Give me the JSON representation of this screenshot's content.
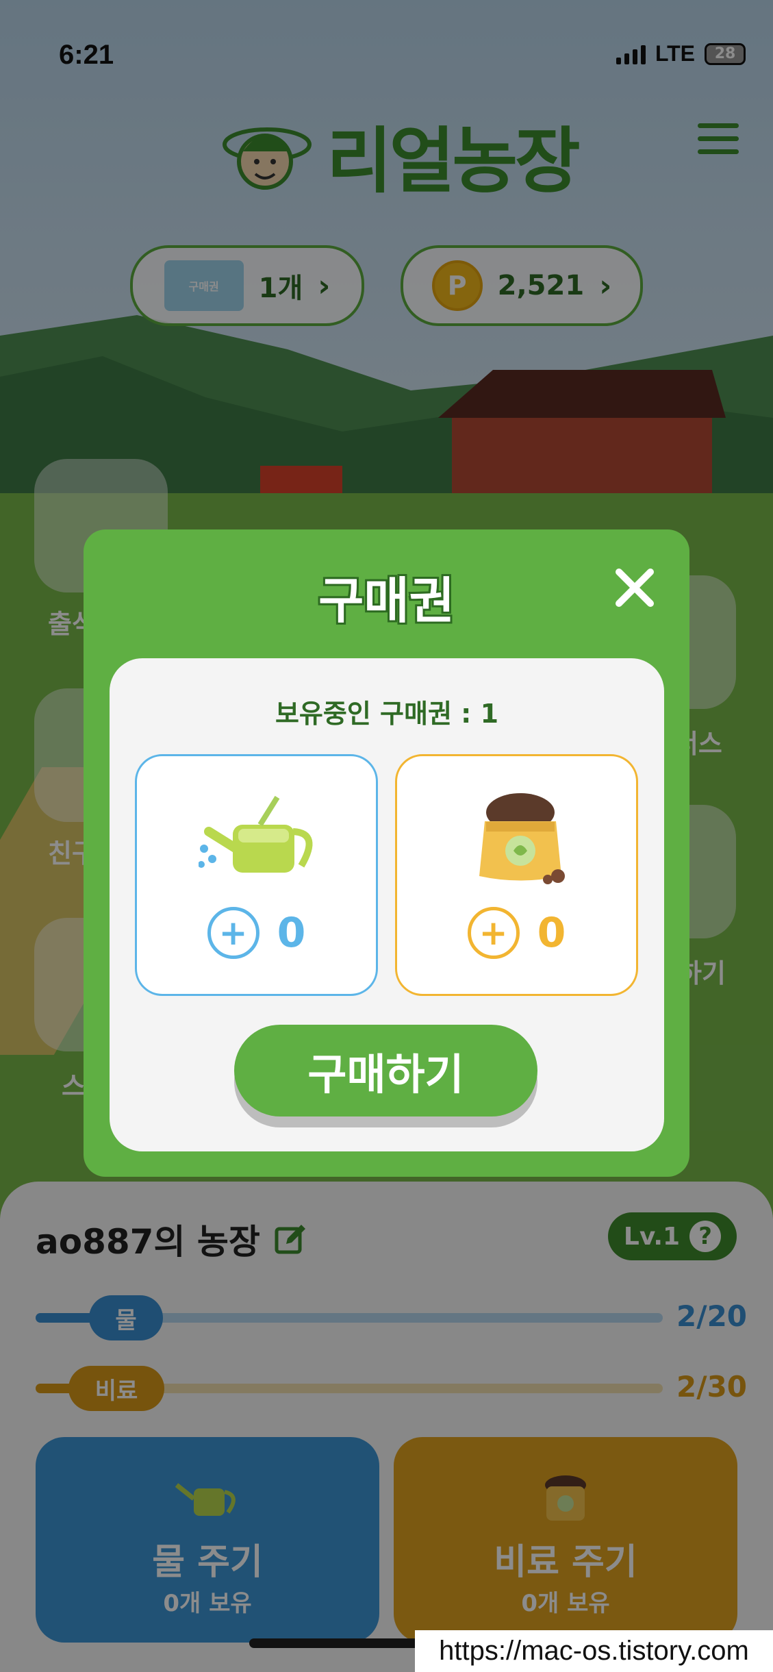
{
  "status_bar": {
    "time": "6:21",
    "network": "LTE",
    "battery": "28"
  },
  "header": {
    "app_title": "리얼농장"
  },
  "currency": {
    "ticket_image_text": "구매권",
    "ticket_count": "1개",
    "coin_symbol": "P",
    "coin_amount": "2,521"
  },
  "side_menu": {
    "items": [
      {
        "label": "출석",
        "icon": "calendar-heart-icon"
      },
      {
        "label": "친구",
        "icon": "envelope-icon"
      },
      {
        "label": "스",
        "icon": "gift-box-icon"
      },
      {
        "label": "보너스",
        "icon": "gift-icon"
      },
      {
        "label": "하기",
        "icon": "book-icon"
      }
    ]
  },
  "modal": {
    "title": "구매권",
    "owned_label": "보유중인 구매권 : 1",
    "items": [
      {
        "name": "water",
        "icon": "watering-can-icon",
        "quantity": "0",
        "color": "#5cb5e8"
      },
      {
        "name": "fertilizer",
        "icon": "fertilizer-bag-icon",
        "quantity": "0",
        "color": "#f2b531"
      }
    ],
    "buy_label": "구매하기"
  },
  "farm": {
    "name": "ao887의 농장",
    "level": "Lv.1",
    "water": {
      "label": "물",
      "count": "2/20",
      "fill": 0.1,
      "color": "#3a8fd1"
    },
    "fertilizer": {
      "label": "비료",
      "count": "2/30",
      "fill": 0.067,
      "color": "#d99a18"
    },
    "actions": [
      {
        "title": "물 주기",
        "sub": "0개 보유",
        "icon": "watering-can-icon",
        "color": "#3d95d6"
      },
      {
        "title": "비료 주기",
        "sub": "0개 보유",
        "icon": "fertilizer-bag-icon",
        "color": "#e0a21f"
      }
    ]
  },
  "watermark": "https://mac-os.tistory.com"
}
